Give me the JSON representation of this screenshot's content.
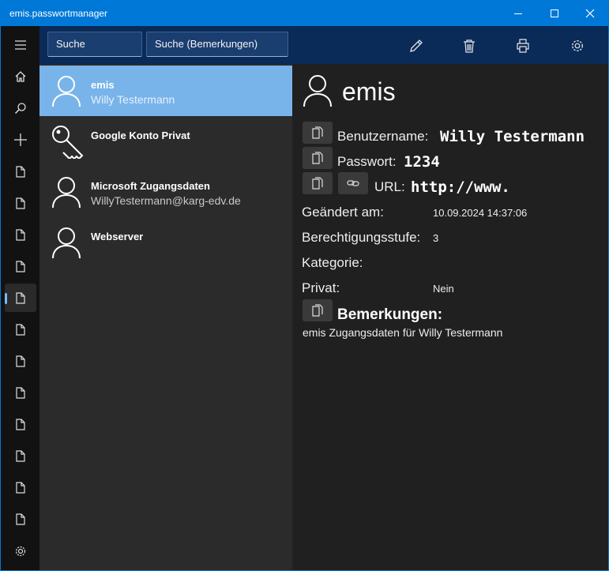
{
  "window": {
    "title": "emis.passwortmanager"
  },
  "search": {
    "placeholder_name": "Suche",
    "placeholder_notes": "Suche (Bemerkungen)"
  },
  "entries": [
    {
      "name": "emis",
      "sub": "Willy Testermann",
      "icon": "person-icon",
      "selected": true
    },
    {
      "name": "Google Konto Privat",
      "sub": "",
      "icon": "key-icon",
      "selected": false
    },
    {
      "name": "Microsoft Zugangsdaten",
      "sub": "WillyTestermann@karg-edv.de",
      "icon": "person-icon",
      "selected": false
    },
    {
      "name": "Webserver",
      "sub": "",
      "icon": "person-icon",
      "selected": false
    }
  ],
  "detail": {
    "title": "emis",
    "username_label": "Benutzername:",
    "username_value": "Willy Testermann",
    "password_label": "Passwort:",
    "password_value": "1234",
    "url_label": "URL:",
    "url_value": "http://www.",
    "changed_label": "Geändert am:",
    "changed_value": "10.09.2024 14:37:06",
    "level_label": "Berechtigungsstufe:",
    "level_value": "3",
    "category_label": "Kategorie:",
    "category_value": "",
    "private_label": "Privat:",
    "private_value": "Nein",
    "notes_label": "Bemerkungen:",
    "notes_value": "emis Zugangsdaten für Willy Testermann"
  },
  "colors": {
    "accent": "#0078d7",
    "selection": "#78b4ea",
    "bar": "#0a2a58"
  }
}
